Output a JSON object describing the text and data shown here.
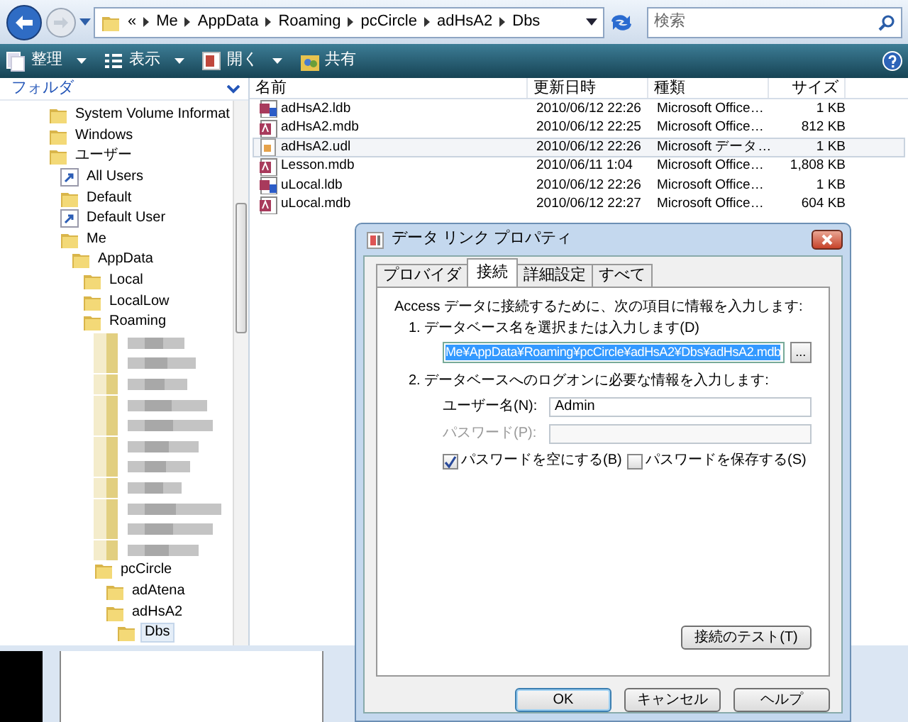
{
  "address_bar": {
    "overflow": "«",
    "segments": [
      "Me",
      "AppData",
      "Roaming",
      "pcCircle",
      "adHsA2",
      "Dbs"
    ]
  },
  "search": {
    "placeholder": "検索"
  },
  "toolbar": [
    {
      "label": "整理",
      "dropdown": true
    },
    {
      "label": "表示",
      "dropdown": true
    },
    {
      "label": "開く",
      "dropdown": true
    },
    {
      "label": "共有",
      "dropdown": false
    }
  ],
  "folder_pane": {
    "title": "フォルダ",
    "tree": [
      {
        "kind": "folder",
        "label": "System Volume Informat",
        "selected": false
      },
      {
        "kind": "folder",
        "label": "Windows",
        "selected": false
      },
      {
        "kind": "folder",
        "label": "ユーザー",
        "selected": false,
        "children": [
          {
            "kind": "shortcut",
            "label": "All Users",
            "selected": false
          },
          {
            "kind": "folder",
            "label": "Default",
            "selected": false
          },
          {
            "kind": "shortcut",
            "label": "Default User",
            "selected": false
          },
          {
            "kind": "folder",
            "label": "Me",
            "selected": false,
            "children": [
              {
                "kind": "folder",
                "label": "AppData",
                "selected": false,
                "children": [
                  {
                    "kind": "folder",
                    "label": "Local",
                    "selected": false
                  },
                  {
                    "kind": "folder",
                    "label": "LocalLow",
                    "selected": false
                  },
                  {
                    "kind": "folder",
                    "label": "Roaming",
                    "selected": false,
                    "children": [
                      {
                        "kind": "blurred"
                      },
                      {
                        "kind": "blurred"
                      },
                      {
                        "kind": "blurred"
                      },
                      {
                        "kind": "blurred"
                      },
                      {
                        "kind": "blurred"
                      },
                      {
                        "kind": "blurred"
                      },
                      {
                        "kind": "blurred"
                      },
                      {
                        "kind": "blurred"
                      },
                      {
                        "kind": "blurred"
                      },
                      {
                        "kind": "blurred"
                      },
                      {
                        "kind": "blurred"
                      },
                      {
                        "kind": "folder",
                        "label": "pcCircle",
                        "selected": false,
                        "children": [
                          {
                            "kind": "folder",
                            "label": "adAtena",
                            "selected": false
                          },
                          {
                            "kind": "folder",
                            "label": "adHsA2",
                            "selected": false,
                            "children": [
                              {
                                "kind": "folder",
                                "label": "Dbs",
                                "selected": true
                              }
                            ]
                          }
                        ]
                      }
                    ]
                  }
                ]
              }
            ]
          }
        ]
      }
    ]
  },
  "file_list": {
    "columns": [
      "名前",
      "更新日時",
      "種類",
      "サイズ"
    ],
    "rows": [
      {
        "kind": "ldb",
        "name": "adHsA2.ldb",
        "modified": "2010/06/12 22:26",
        "type": "Microsoft Office…",
        "size": "1 KB",
        "selected": false
      },
      {
        "kind": "mdb",
        "name": "adHsA2.mdb",
        "modified": "2010/06/12 22:25",
        "type": "Microsoft Office…",
        "size": "812 KB",
        "selected": false
      },
      {
        "kind": "udl",
        "name": "adHsA2.udl",
        "modified": "2010/06/12 22:26",
        "type": "Microsoft データ…",
        "size": "1 KB",
        "selected": true
      },
      {
        "kind": "mdb",
        "name": "Lesson.mdb",
        "modified": "2010/06/11 1:04",
        "type": "Microsoft Office…",
        "size": "1,808 KB",
        "selected": false
      },
      {
        "kind": "ldb",
        "name": "uLocal.ldb",
        "modified": "2010/06/12 22:26",
        "type": "Microsoft Office…",
        "size": "1 KB",
        "selected": false
      },
      {
        "kind": "mdb",
        "name": "uLocal.mdb",
        "modified": "2010/06/12 22:27",
        "type": "Microsoft Office…",
        "size": "604 KB",
        "selected": false
      }
    ]
  },
  "dialog": {
    "title": "データ リンク プロパティ",
    "tabs": [
      {
        "label": "プロバイダ",
        "selected": false
      },
      {
        "label": "接続",
        "selected": true
      },
      {
        "label": "詳細設定",
        "selected": false
      },
      {
        "label": "すべて",
        "selected": false
      }
    ],
    "intro": "Access データに接続するために、次の項目に情報を入力します:",
    "step1": "1. データベース名を選択または入力します(D)",
    "database": {
      "value": "Me¥AppData¥Roaming¥pcCircle¥adHsA2¥Dbs¥adHsA2.mdb",
      "selected": true
    },
    "browse_button": "...",
    "step2": "2. データベースへのログオンに必要な情報を入力します:",
    "fields": [
      {
        "label": "ユーザー名(N):",
        "value": "Admin",
        "disabled": false
      },
      {
        "label": "パスワード(P):",
        "disabled": true
      }
    ],
    "checkboxes": [
      {
        "label": "パスワードを空にする(B)",
        "checked": true
      },
      {
        "label": "パスワードを保存する(S)",
        "checked": false
      }
    ],
    "test_button": "接続のテスト(T)",
    "buttons": [
      {
        "label": "OK",
        "default": true
      },
      {
        "label": "キャンセル",
        "default": false
      },
      {
        "label": "ヘルプ",
        "default": false
      }
    ]
  }
}
